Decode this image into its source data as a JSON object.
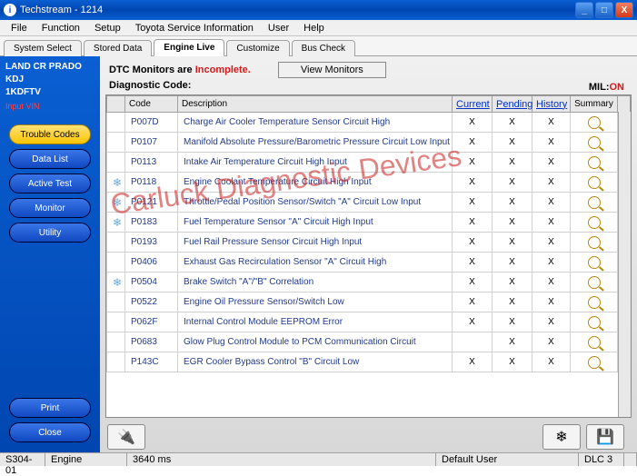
{
  "window": {
    "title": "Techstream - 1214"
  },
  "menu": [
    "File",
    "Function",
    "Setup",
    "Toyota Service Information",
    "User",
    "Help"
  ],
  "tabs": [
    {
      "label": "System Select",
      "active": false
    },
    {
      "label": "Stored Data",
      "active": false
    },
    {
      "label": "Engine Live",
      "active": true
    },
    {
      "label": "Customize",
      "active": false
    },
    {
      "label": "Bus Check",
      "active": false
    }
  ],
  "vehicle": {
    "model": "LAND CR PRADO",
    "variant": "KDJ",
    "engine": "1KDFTV",
    "input_vin": "Input VIN"
  },
  "side_buttons": [
    {
      "label": "Trouble Codes",
      "style": "yellow"
    },
    {
      "label": "Data List",
      "style": "blue"
    },
    {
      "label": "Active Test",
      "style": "blue"
    },
    {
      "label": "Monitor",
      "style": "blue"
    },
    {
      "label": "Utility",
      "style": "blue"
    }
  ],
  "bottom_side": [
    {
      "label": "Print",
      "style": "blue"
    },
    {
      "label": "Close",
      "style": "blue"
    }
  ],
  "header": {
    "dtc_prefix": "DTC Monitors are ",
    "dtc_status": "Incomplete.",
    "view_monitors": "View Monitors",
    "diag_label": "Diagnostic Code:",
    "mil_label": "MIL:",
    "mil_value": "ON"
  },
  "columns": {
    "freeze": "",
    "code": "Code",
    "desc": "Description",
    "current": "Current",
    "pending": "Pending",
    "history": "History",
    "summary": "Summary"
  },
  "rows": [
    {
      "freeze": "",
      "code": "P007D",
      "desc": "Charge Air Cooler Temperature Sensor Circuit High",
      "cur": "X",
      "pen": "X",
      "his": "X"
    },
    {
      "freeze": "",
      "code": "P0107",
      "desc": "Manifold Absolute Pressure/Barometric Pressure Circuit Low Input",
      "cur": "X",
      "pen": "X",
      "his": "X"
    },
    {
      "freeze": "",
      "code": "P0113",
      "desc": "Intake Air Temperature Circuit High Input",
      "cur": "X",
      "pen": "X",
      "his": "X"
    },
    {
      "freeze": "❄",
      "code": "P0118",
      "desc": "Engine Coolant Temperature Circuit High Input",
      "cur": "X",
      "pen": "X",
      "his": "X"
    },
    {
      "freeze": "❄",
      "code": "P0121",
      "desc": "Throttle/Pedal Position Sensor/Switch \"A\" Circuit Low Input",
      "cur": "X",
      "pen": "X",
      "his": "X"
    },
    {
      "freeze": "❄",
      "code": "P0183",
      "desc": "Fuel Temperature Sensor \"A\" Circuit High Input",
      "cur": "X",
      "pen": "X",
      "his": "X"
    },
    {
      "freeze": "",
      "code": "P0193",
      "desc": "Fuel Rail Pressure Sensor Circuit High Input",
      "cur": "X",
      "pen": "X",
      "his": "X"
    },
    {
      "freeze": "",
      "code": "P0406",
      "desc": "Exhaust Gas Recirculation Sensor \"A\" Circuit High",
      "cur": "X",
      "pen": "X",
      "his": "X"
    },
    {
      "freeze": "❄",
      "code": "P0504",
      "desc": "Brake Switch \"A\"/\"B\" Correlation",
      "cur": "X",
      "pen": "X",
      "his": "X"
    },
    {
      "freeze": "",
      "code": "P0522",
      "desc": "Engine Oil Pressure Sensor/Switch Low",
      "cur": "X",
      "pen": "X",
      "his": "X"
    },
    {
      "freeze": "",
      "code": "P062F",
      "desc": "Internal Control Module EEPROM Error",
      "cur": "X",
      "pen": "X",
      "his": "X"
    },
    {
      "freeze": "",
      "code": "P0683",
      "desc": "Glow Plug Control Module to PCM Communication Circuit",
      "cur": "",
      "pen": "X",
      "his": "X"
    },
    {
      "freeze": "",
      "code": "P143C",
      "desc": "EGR Cooler Bypass Control \"B\" Circuit Low",
      "cur": "X",
      "pen": "X",
      "his": "X"
    }
  ],
  "status": {
    "left1": "S304-01",
    "left2": "Engine",
    "ms": "3640 ms",
    "user": "Default User",
    "dlc": "DLC 3"
  },
  "watermark": "Carluck Diagnostic Devices"
}
